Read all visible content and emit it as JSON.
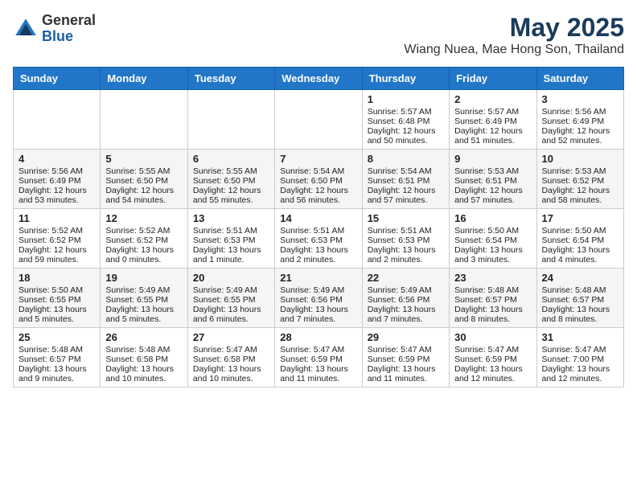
{
  "logo": {
    "general": "General",
    "blue": "Blue"
  },
  "header": {
    "month": "May 2025",
    "location": "Wiang Nuea, Mae Hong Son, Thailand"
  },
  "weekdays": [
    "Sunday",
    "Monday",
    "Tuesday",
    "Wednesday",
    "Thursday",
    "Friday",
    "Saturday"
  ],
  "weeks": [
    [
      {
        "day": "",
        "sunrise": "",
        "sunset": "",
        "daylight": ""
      },
      {
        "day": "",
        "sunrise": "",
        "sunset": "",
        "daylight": ""
      },
      {
        "day": "",
        "sunrise": "",
        "sunset": "",
        "daylight": ""
      },
      {
        "day": "",
        "sunrise": "",
        "sunset": "",
        "daylight": ""
      },
      {
        "day": "1",
        "sunrise": "Sunrise: 5:57 AM",
        "sunset": "Sunset: 6:48 PM",
        "daylight": "Daylight: 12 hours and 50 minutes."
      },
      {
        "day": "2",
        "sunrise": "Sunrise: 5:57 AM",
        "sunset": "Sunset: 6:49 PM",
        "daylight": "Daylight: 12 hours and 51 minutes."
      },
      {
        "day": "3",
        "sunrise": "Sunrise: 5:56 AM",
        "sunset": "Sunset: 6:49 PM",
        "daylight": "Daylight: 12 hours and 52 minutes."
      }
    ],
    [
      {
        "day": "4",
        "sunrise": "Sunrise: 5:56 AM",
        "sunset": "Sunset: 6:49 PM",
        "daylight": "Daylight: 12 hours and 53 minutes."
      },
      {
        "day": "5",
        "sunrise": "Sunrise: 5:55 AM",
        "sunset": "Sunset: 6:50 PM",
        "daylight": "Daylight: 12 hours and 54 minutes."
      },
      {
        "day": "6",
        "sunrise": "Sunrise: 5:55 AM",
        "sunset": "Sunset: 6:50 PM",
        "daylight": "Daylight: 12 hours and 55 minutes."
      },
      {
        "day": "7",
        "sunrise": "Sunrise: 5:54 AM",
        "sunset": "Sunset: 6:50 PM",
        "daylight": "Daylight: 12 hours and 56 minutes."
      },
      {
        "day": "8",
        "sunrise": "Sunrise: 5:54 AM",
        "sunset": "Sunset: 6:51 PM",
        "daylight": "Daylight: 12 hours and 57 minutes."
      },
      {
        "day": "9",
        "sunrise": "Sunrise: 5:53 AM",
        "sunset": "Sunset: 6:51 PM",
        "daylight": "Daylight: 12 hours and 57 minutes."
      },
      {
        "day": "10",
        "sunrise": "Sunrise: 5:53 AM",
        "sunset": "Sunset: 6:52 PM",
        "daylight": "Daylight: 12 hours and 58 minutes."
      }
    ],
    [
      {
        "day": "11",
        "sunrise": "Sunrise: 5:52 AM",
        "sunset": "Sunset: 6:52 PM",
        "daylight": "Daylight: 12 hours and 59 minutes."
      },
      {
        "day": "12",
        "sunrise": "Sunrise: 5:52 AM",
        "sunset": "Sunset: 6:52 PM",
        "daylight": "Daylight: 13 hours and 0 minutes."
      },
      {
        "day": "13",
        "sunrise": "Sunrise: 5:51 AM",
        "sunset": "Sunset: 6:53 PM",
        "daylight": "Daylight: 13 hours and 1 minute."
      },
      {
        "day": "14",
        "sunrise": "Sunrise: 5:51 AM",
        "sunset": "Sunset: 6:53 PM",
        "daylight": "Daylight: 13 hours and 2 minutes."
      },
      {
        "day": "15",
        "sunrise": "Sunrise: 5:51 AM",
        "sunset": "Sunset: 6:53 PM",
        "daylight": "Daylight: 13 hours and 2 minutes."
      },
      {
        "day": "16",
        "sunrise": "Sunrise: 5:50 AM",
        "sunset": "Sunset: 6:54 PM",
        "daylight": "Daylight: 13 hours and 3 minutes."
      },
      {
        "day": "17",
        "sunrise": "Sunrise: 5:50 AM",
        "sunset": "Sunset: 6:54 PM",
        "daylight": "Daylight: 13 hours and 4 minutes."
      }
    ],
    [
      {
        "day": "18",
        "sunrise": "Sunrise: 5:50 AM",
        "sunset": "Sunset: 6:55 PM",
        "daylight": "Daylight: 13 hours and 5 minutes."
      },
      {
        "day": "19",
        "sunrise": "Sunrise: 5:49 AM",
        "sunset": "Sunset: 6:55 PM",
        "daylight": "Daylight: 13 hours and 5 minutes."
      },
      {
        "day": "20",
        "sunrise": "Sunrise: 5:49 AM",
        "sunset": "Sunset: 6:55 PM",
        "daylight": "Daylight: 13 hours and 6 minutes."
      },
      {
        "day": "21",
        "sunrise": "Sunrise: 5:49 AM",
        "sunset": "Sunset: 6:56 PM",
        "daylight": "Daylight: 13 hours and 7 minutes."
      },
      {
        "day": "22",
        "sunrise": "Sunrise: 5:49 AM",
        "sunset": "Sunset: 6:56 PM",
        "daylight": "Daylight: 13 hours and 7 minutes."
      },
      {
        "day": "23",
        "sunrise": "Sunrise: 5:48 AM",
        "sunset": "Sunset: 6:57 PM",
        "daylight": "Daylight: 13 hours and 8 minutes."
      },
      {
        "day": "24",
        "sunrise": "Sunrise: 5:48 AM",
        "sunset": "Sunset: 6:57 PM",
        "daylight": "Daylight: 13 hours and 8 minutes."
      }
    ],
    [
      {
        "day": "25",
        "sunrise": "Sunrise: 5:48 AM",
        "sunset": "Sunset: 6:57 PM",
        "daylight": "Daylight: 13 hours and 9 minutes."
      },
      {
        "day": "26",
        "sunrise": "Sunrise: 5:48 AM",
        "sunset": "Sunset: 6:58 PM",
        "daylight": "Daylight: 13 hours and 10 minutes."
      },
      {
        "day": "27",
        "sunrise": "Sunrise: 5:47 AM",
        "sunset": "Sunset: 6:58 PM",
        "daylight": "Daylight: 13 hours and 10 minutes."
      },
      {
        "day": "28",
        "sunrise": "Sunrise: 5:47 AM",
        "sunset": "Sunset: 6:59 PM",
        "daylight": "Daylight: 13 hours and 11 minutes."
      },
      {
        "day": "29",
        "sunrise": "Sunrise: 5:47 AM",
        "sunset": "Sunset: 6:59 PM",
        "daylight": "Daylight: 13 hours and 11 minutes."
      },
      {
        "day": "30",
        "sunrise": "Sunrise: 5:47 AM",
        "sunset": "Sunset: 6:59 PM",
        "daylight": "Daylight: 13 hours and 12 minutes."
      },
      {
        "day": "31",
        "sunrise": "Sunrise: 5:47 AM",
        "sunset": "Sunset: 7:00 PM",
        "daylight": "Daylight: 13 hours and 12 minutes."
      }
    ]
  ]
}
